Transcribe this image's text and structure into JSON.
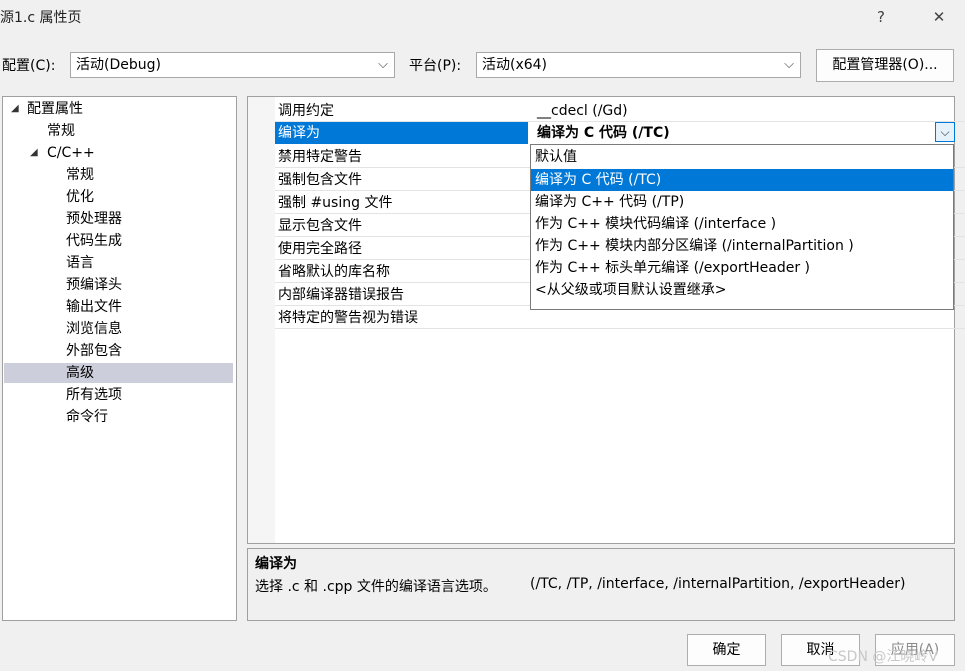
{
  "window": {
    "title": "源1.c 属性页",
    "help_glyph": "?",
    "close_glyph": "✕"
  },
  "config": {
    "config_label": "配置(C):",
    "config_value": "活动(Debug)",
    "platform_label": "平台(P):",
    "platform_value": "活动(x64)",
    "manager_button": "配置管理器(O)..."
  },
  "tree": {
    "root": "配置属性",
    "general": "常规",
    "cpp": "C/C++",
    "children": [
      "常规",
      "优化",
      "预处理器",
      "代码生成",
      "语言",
      "预编译头",
      "输出文件",
      "浏览信息",
      "外部包含",
      "高级",
      "所有选项",
      "命令行"
    ],
    "selected": "高级"
  },
  "properties": [
    {
      "name": "调用约定",
      "value": "__cdecl (/Gd)"
    },
    {
      "name": "编译为",
      "value": "编译为 C 代码 (/TC)"
    },
    {
      "name": "禁用特定警告",
      "value": ""
    },
    {
      "name": "强制包含文件",
      "value": ""
    },
    {
      "name": "强制 #using 文件",
      "value": ""
    },
    {
      "name": "显示包含文件",
      "value": ""
    },
    {
      "name": "使用完全路径",
      "value": ""
    },
    {
      "name": "省略默认的库名称",
      "value": ""
    },
    {
      "name": "内部编译器错误报告",
      "value": ""
    },
    {
      "name": "将特定的警告视为错误",
      "value": ""
    }
  ],
  "dropdown_options": [
    "默认值",
    "编译为 C 代码 (/TC)",
    "编译为 C++ 代码 (/TP)",
    "作为 C++ 模块代码编译 (/interface )",
    "作为 C++ 模块内部分区编译 (/internalPartition )",
    "作为 C++ 标头单元编译 (/exportHeader )",
    "<从父级或项目默认设置继承>"
  ],
  "description": {
    "title": "编译为",
    "text": "选择 .c 和 .cpp 文件的编译语言选项。",
    "switches": "(/TC, /TP, /interface, /internalPartition, /exportHeader)"
  },
  "buttons": {
    "ok": "确定",
    "cancel": "取消",
    "apply": "应用(A)"
  },
  "watermark": "CSDN @江晓岭V",
  "icons": {
    "expanded": "◢",
    "dropdown_arrow": "⌵"
  }
}
